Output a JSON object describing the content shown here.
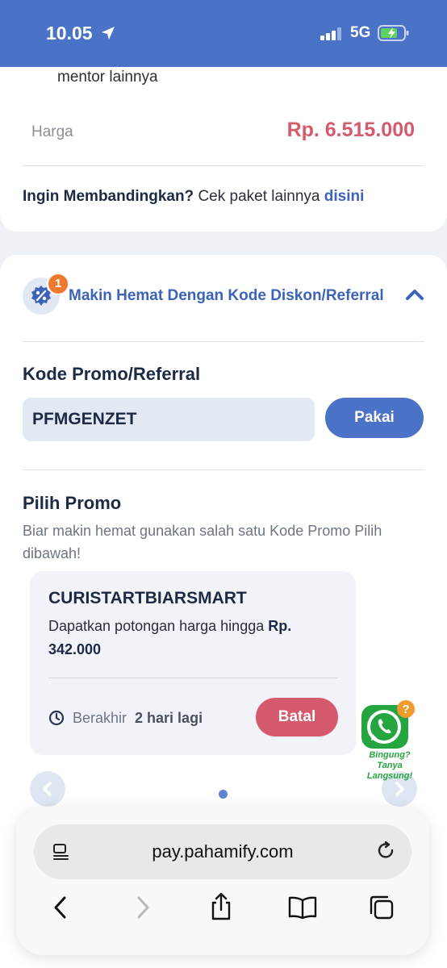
{
  "status_bar": {
    "time": "10.05",
    "network": "5G"
  },
  "package": {
    "mentor_text": "mentor lainnya",
    "price_label": "Harga",
    "price_value": "Rp. 6.515.000",
    "compare_bold": "Ingin Membandingkan?",
    "compare_text": " Cek paket lainnya ",
    "compare_link": "disini"
  },
  "discount": {
    "badge_count": "1",
    "title": "Makin Hemat Dengan Kode Diskon/Referral",
    "code_label": "Kode Promo/Referral",
    "code_value": "PFMGENZET",
    "apply_button": "Pakai"
  },
  "promo_list": {
    "title": "Pilih Promo",
    "description": "Biar makin hemat gunakan salah satu Kode Promo Pilih dibawah!",
    "items": [
      {
        "code": "CURISTARTBIARSMART",
        "desc_text": "Dapatkan potongan harga hingga ",
        "desc_amount": "Rp. 342.000",
        "expiry_label": "Berakhir",
        "expiry_value": "2 hari lagi",
        "cancel_button": "Batal"
      }
    ]
  },
  "whatsapp": {
    "line1": "Bingung?",
    "line2": "Tanya Langsung!"
  },
  "browser": {
    "url": "pay.pahamify.com"
  },
  "colors": {
    "primary": "#4a72c6",
    "accent": "#d65a6d",
    "badge": "#ef7a2d",
    "whatsapp": "#25d366"
  }
}
